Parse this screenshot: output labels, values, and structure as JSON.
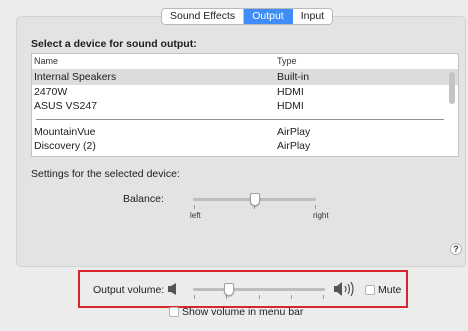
{
  "tabs": [
    {
      "label": "Sound Effects",
      "active": false
    },
    {
      "label": "Output",
      "active": true
    },
    {
      "label": "Input",
      "active": false
    }
  ],
  "heading": "Select a device for sound output:",
  "table": {
    "columns": [
      "Name",
      "Type"
    ],
    "rows": [
      {
        "name": "Internal Speakers",
        "type": "Built-in",
        "selected": true
      },
      {
        "name": "2470W",
        "type": "HDMI"
      },
      {
        "name": "ASUS VS247",
        "type": "HDMI"
      },
      {
        "name": "MountainVue",
        "type": "AirPlay"
      },
      {
        "name": "Discovery (2)",
        "type": "AirPlay"
      }
    ]
  },
  "settings_heading": "Settings for the selected device:",
  "balance": {
    "label": "Balance:",
    "left": "left",
    "right": "right",
    "value": 0.5
  },
  "help": "?",
  "output_volume": {
    "label": "Output volume:",
    "value": 0.27,
    "mute_label": "Mute",
    "muted": false
  },
  "show_volume": {
    "label": "Show volume in menu bar",
    "checked": false
  },
  "colors": {
    "accent": "#3f8df6",
    "highlight_box": "#d8262d",
    "selected_row": "#dcdcdc"
  },
  "icons": {
    "speaker_low": "speaker-low-icon",
    "speaker_high": "speaker-high-icon",
    "help": "help-icon"
  }
}
